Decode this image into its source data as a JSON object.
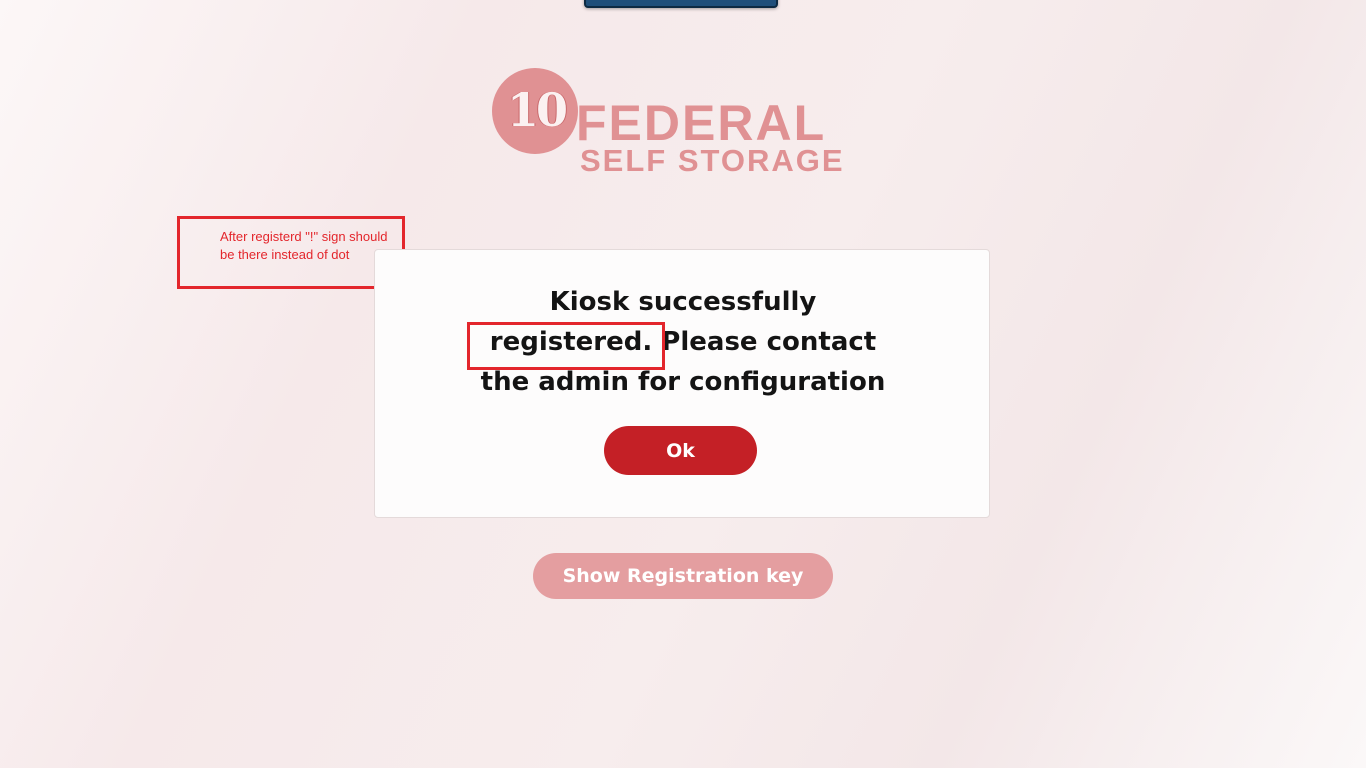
{
  "logo": {
    "number": "10",
    "word_primary": "FEDERAL",
    "word_secondary": "SELF STORAGE",
    "color": "#e09193"
  },
  "dialog": {
    "message": "Kiosk successfully registered. Please contact the admin for configuration",
    "ok_label": "Ok",
    "ok_color": "#c42026"
  },
  "registration": {
    "button_label": "Show Registration key",
    "button_color": "#e49ea0"
  },
  "annotation": {
    "note": "After registerd \"!\" sign should be there instead of dot",
    "color": "#e3262c"
  }
}
